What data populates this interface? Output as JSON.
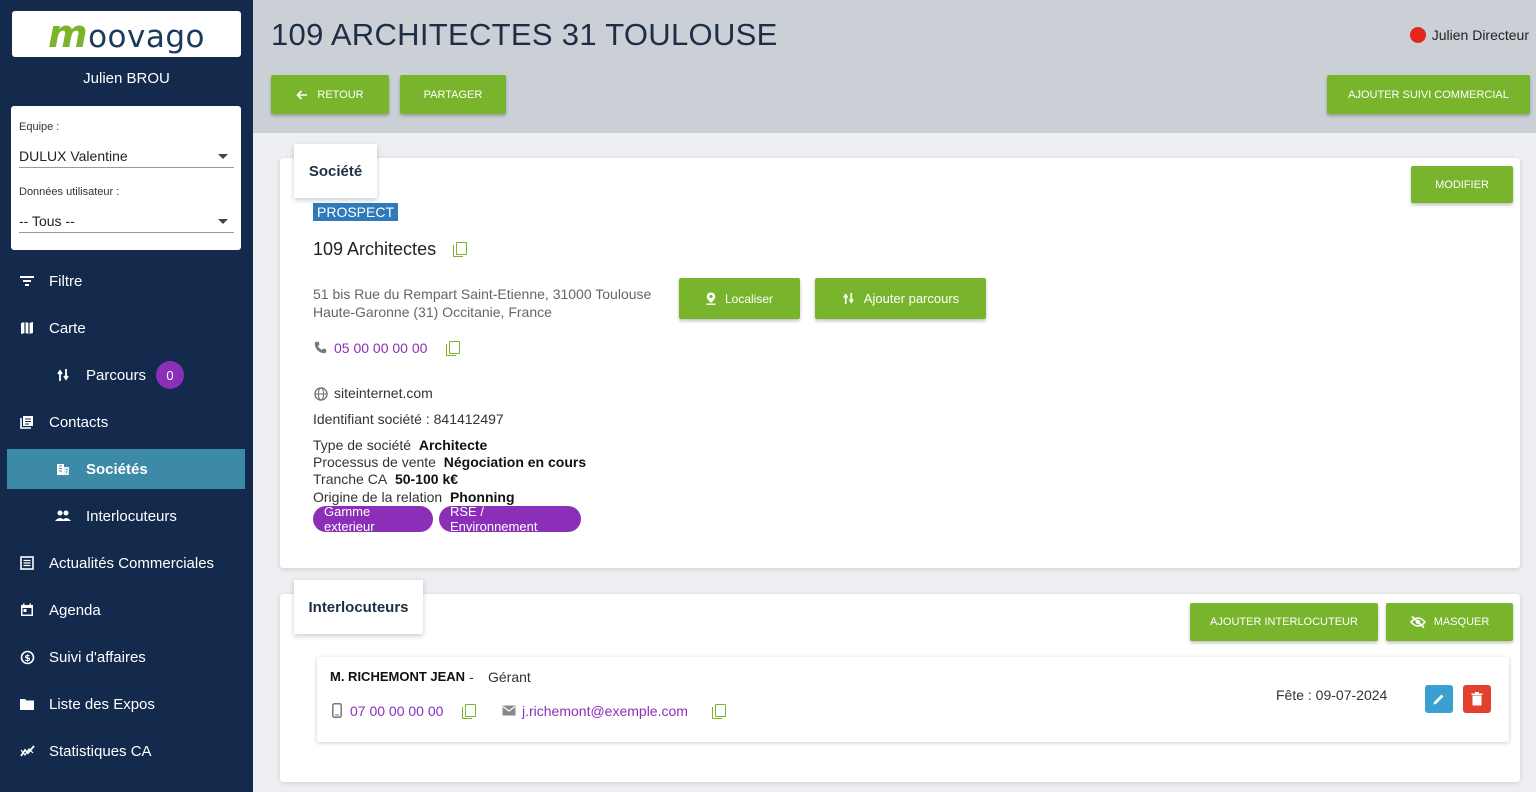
{
  "brand": {
    "logo_m": "m",
    "logo_rest": "oovago",
    "accent": "#79b52c",
    "sidebar_bg": "#142a4c"
  },
  "sidebar": {
    "username": "Julien BROU",
    "filters": {
      "team_label": "Equipe :",
      "team_value": "DULUX Valentine",
      "data_label": "Données utilisateur :",
      "data_value": "-- Tous --"
    },
    "items": [
      {
        "label": "Filtre",
        "icon": "filter-icon"
      },
      {
        "label": "Carte",
        "icon": "map-icon"
      },
      {
        "label": "Parcours",
        "icon": "route-icon",
        "count": "0"
      },
      {
        "label": "Contacts",
        "icon": "contacts-icon"
      },
      {
        "label": "Sociétés",
        "icon": "building-icon",
        "active": true
      },
      {
        "label": "Interlocuteurs",
        "icon": "people-icon"
      },
      {
        "label": "Actualités Commerciales",
        "icon": "news-icon"
      },
      {
        "label": "Agenda",
        "icon": "calendar-icon"
      },
      {
        "label": "Suivi d'affaires",
        "icon": "money-icon"
      },
      {
        "label": "Liste des Expos",
        "icon": "folder-icon"
      },
      {
        "label": "Statistiques CA",
        "icon": "stats-icon"
      }
    ]
  },
  "header": {
    "title": "109 ARCHITECTES 31 TOULOUSE",
    "user": "Julien Directeur",
    "status_color": "#e4281c",
    "back_label": "RETOUR",
    "share_label": "PARTAGER",
    "add_followup_label": "AJOUTER SUIVI COMMERCIAL"
  },
  "company": {
    "tab_label": "Société",
    "modify_label": "MODIFIER",
    "status": "PROSPECT",
    "name": "109 Architectes",
    "address_line1": "51 bis Rue du Rempart Saint-Etienne, 31000 Toulouse",
    "address_line2": "Haute-Garonne (31) Occitanie, France",
    "locate_label": "Localiser",
    "add_route_label": "Ajouter parcours",
    "phone": "05 00 00 00 00",
    "website": "siteinternet.com",
    "identifier": "Identifiant société : 841412497",
    "details": [
      {
        "label": "Type de société",
        "value": "Architecte"
      },
      {
        "label": "Processus de vente",
        "value": "Négociation en cours"
      },
      {
        "label": "Tranche CA",
        "value": "50-100 k€"
      },
      {
        "label": "Origine de la relation",
        "value": "Phonning"
      }
    ],
    "tags": [
      "Gamme exterieur",
      "RSE / Environnement"
    ]
  },
  "contacts": {
    "tab_label": "Interlocuteurs",
    "add_label": "AJOUTER INTERLOCUTEUR",
    "hide_label": "MASQUER",
    "items": [
      {
        "name": "M. RICHEMONT JEAN",
        "separator": "-",
        "role": "Gérant",
        "phone": "07 00 00 00 00",
        "email": "j.richemont@exemple.com",
        "birthday": "Fête : 09-07-2024"
      }
    ]
  }
}
